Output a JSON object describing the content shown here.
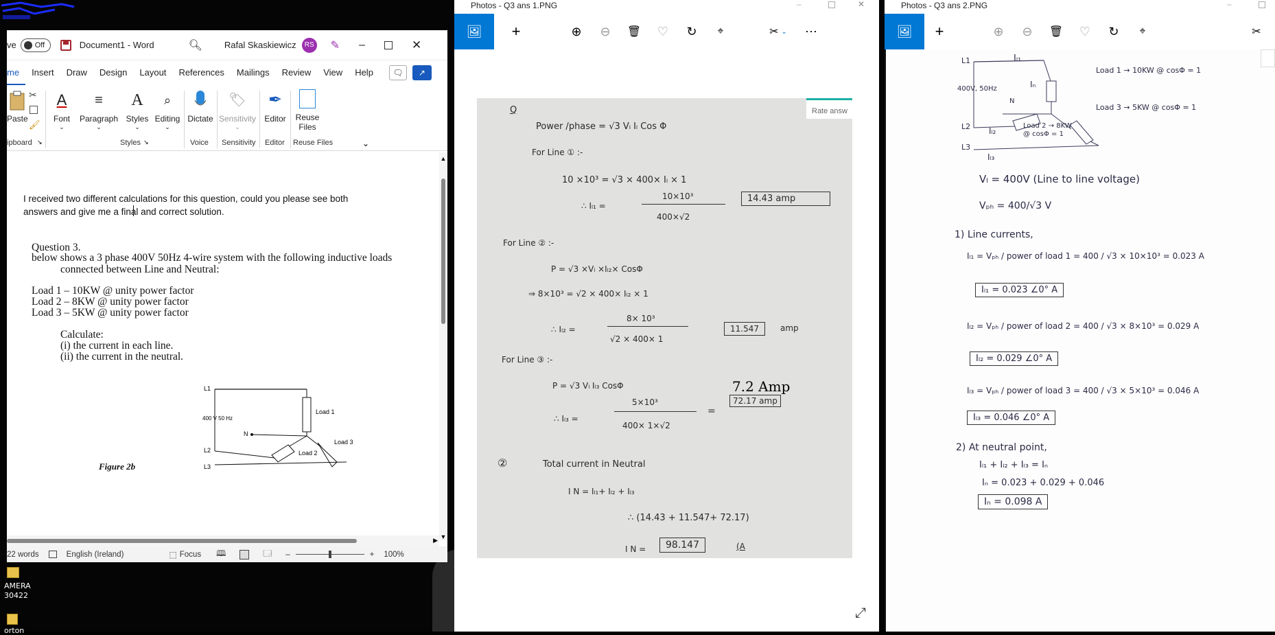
{
  "desktop": {
    "icon_labels": [
      "AMERA",
      "30422",
      "orton"
    ]
  },
  "word": {
    "autosave_label": "ve",
    "autosave_state": "Off",
    "doc_name": "Document1 - Word",
    "user_name": "Rafal Skaskiewicz",
    "user_initials": "RS",
    "tabs": [
      "me",
      "Insert",
      "Draw",
      "Design",
      "Layout",
      "References",
      "Mailings",
      "Review",
      "View",
      "Help"
    ],
    "ribbon": {
      "paste": "Paste",
      "font": "Font",
      "paragraph": "Paragraph",
      "styles": "Styles",
      "editing": "Editing",
      "dictate": "Dictate",
      "sensitivity": "Sensitivity",
      "editor": "Editor",
      "reuse_files": "Reuse Files",
      "groups": [
        "ipboard",
        "Styles",
        "Voice",
        "Sensitivity",
        "Editor",
        "Reuse Files"
      ]
    },
    "body_intro": "I received two different calculations for this question, could you please see both answers and give me a final and correct solution.",
    "question_title": "Question 3.",
    "question_line1": "below shows a 3 phase 400V 50Hz 4-wire system with the following inductive loads",
    "question_line2": "connected between Line and Neutral:",
    "loads": [
      "Load 1 – 10KW @ unity power factor",
      "Load 2 – 8KW @ unity power factor",
      "Load 3 – 5KW @ unity power factor"
    ],
    "calculate": "Calculate:",
    "calc_items": [
      "(i) the current in each line.",
      "(ii) the current in the neutral."
    ],
    "figure_caption": "Figure 2b",
    "diagram": {
      "l1": "L1",
      "l2": "L2",
      "l3": "L3",
      "n": "N",
      "supply": "400 V  50 Hz",
      "load1": "Load 1",
      "load2": "Load 2",
      "load3": "Load 3"
    },
    "status": {
      "words": "22 words",
      "language": "English (Ireland)",
      "focus": "Focus",
      "zoom": "100%"
    }
  },
  "photos1": {
    "title": "Photos - Q3 ans 1.PNG",
    "rate_label": "Rate answ",
    "sheet": {
      "marker": "Q",
      "formula": "Power /phase = √3 Vₗ Iₗ Cos Φ",
      "line1_hdr": "For   Line  ① :-",
      "line1_eq": "10 ×10³ = √3 × 400× Iₗ × 1",
      "line1_frac_num": "10×10³",
      "line1_frac_den": "400×√2",
      "line1_lhs": "∴  Iₗ₁ =",
      "line1_result": "14.43 amp",
      "line2_hdr": "For    Line  ② :-",
      "line2_eq": "P =  √3 ×Vₗ ×Iₗ₂× CosΦ",
      "line2_eq2": "⇒  8×10³ =  √2 × 400× Iₗ₂ × 1",
      "line2_lhs": "∴  Iₗ₂ =",
      "line2_frac_num": "8× 10³",
      "line2_frac_den": "√2 × 400× 1",
      "line2_result": "11.547",
      "line2_unit": "amp",
      "line3_hdr": "For    Line  ③ :-",
      "line3_eq": "P =   √3   Vₗ   Iₗ₃ CosΦ",
      "line3_lhs": "∴  Iₗ₃ =",
      "line3_frac_num": "5×10³",
      "line3_frac_den": "400× 1×√2",
      "line3_annot": "7.2 Amp",
      "line3_result": "72.17 amp",
      "neutral_num": "②",
      "neutral_hdr": "Total  current   in   Neutral",
      "neutral_eq": "I N =    Iₗ₁+ Iₗ₂ +  Iₗ₃",
      "neutral_sum": "∴ (14.43 +   11.547+  72.17)",
      "neutral_lhs": "I N =",
      "neutral_result": "98.147",
      "neutral_tail": "(A"
    }
  },
  "photos2": {
    "title": "Photos - Q3 ans 2.PNG",
    "sheet": {
      "l1": "L1",
      "l2": "L2",
      "l3": "L3",
      "n": "N",
      "il1": "Iₗ₁",
      "in": "Iₙ",
      "il2": "Iₗ₂",
      "il3": "Iₗ₃",
      "supply": "400V, 50Hz",
      "load1": "Load 1 → 10KW @ cosΦ = 1",
      "load3": "Load 3 → 5KW @ cosΦ = 1",
      "load2": "Load 2 → 8KW @ cosΦ = 1",
      "vl": "Vₗ = 400V (Line to line voltage)",
      "vph": "Vₚₕ = 400/√3 V",
      "s1": "1) Line currents,",
      "il1_eq": "Iₗ₁ =  Vₚₕ / power of load 1  =  400 / √3 × 10×10³  = 0.023 A",
      "il1_box": "Iₗ₁ = 0.023 ∠0° A",
      "il2_eq": "Iₗ₂ =  Vₚₕ / power of load 2  =  400 / √3 × 8×10³  = 0.029 A",
      "il2_box": "Iₗ₂ = 0.029 ∠0° A",
      "il3_eq": "Iₗ₃ =  Vₚₕ / power of load 3  =  400 / √3 × 5×10³  = 0.046 A",
      "il3_box": "Iₗ₃ = 0.046 ∠0° A",
      "s2": "2) At neutral point,",
      "kcl": "Iₗ₁ + Iₗ₂ + Iₗ₃ = Iₙ",
      "in_sum": "Iₙ = 0.023 + 0.029 + 0.046",
      "in_box": "Iₙ = 0.098 A"
    }
  },
  "colors": {
    "accent": "#0078d4",
    "word_blue": "#185abd",
    "avatar": "#9b2fae"
  }
}
